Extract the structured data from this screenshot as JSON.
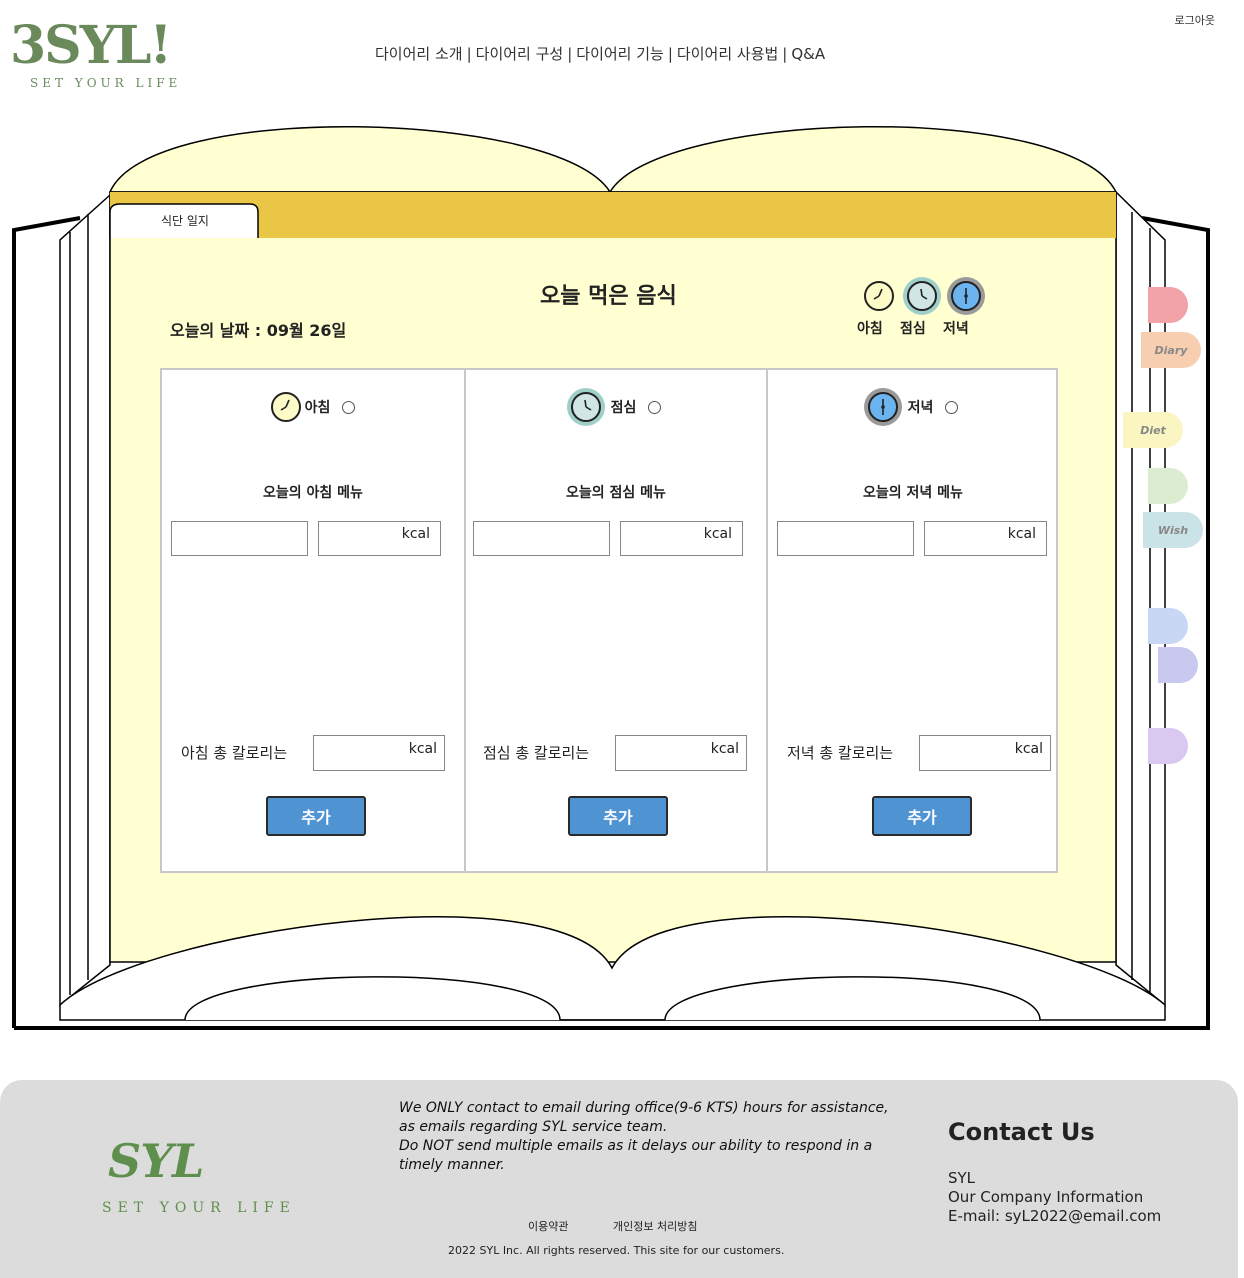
{
  "header": {
    "logo_text": "3SYL!",
    "logo_sub": "SET YOUR LIFE",
    "nav": [
      "다이어리 소개",
      "다이어리 구성",
      "다이어리 기능",
      "다이어리 사용법",
      "Q&A"
    ],
    "nav_separator": "|",
    "logout": "로그아웃"
  },
  "book": {
    "tab_label": "식단 일지",
    "title": "오늘 먹은 음식",
    "date_label": "오늘의 날짜 : 09월 26일",
    "legend": [
      "아침",
      "점심",
      "저녁"
    ],
    "colors": {
      "page": "#ffffd1",
      "top_bar": "#e9c646",
      "button": "#4f93d3"
    }
  },
  "meals": [
    {
      "name": "아침",
      "menu_title": "오늘의 아침 메뉴",
      "food_value": "",
      "kcal_unit": "kcal",
      "total_label": "아침 총 칼로리는",
      "total_unit": "kcal",
      "add_label": "추가",
      "icon_bg": "#fdfbc8",
      "icon_ring": "#f4ecb0"
    },
    {
      "name": "점심",
      "menu_title": "오늘의 점심 메뉴",
      "food_value": "",
      "kcal_unit": "kcal",
      "total_label": "점심 총 칼로리는",
      "total_unit": "kcal",
      "add_label": "추가",
      "icon_bg": "#cfe6e4",
      "icon_ring": "#9fcfc9"
    },
    {
      "name": "저녁",
      "menu_title": "오늘의 저녁 메뉴",
      "food_value": "",
      "kcal_unit": "kcal",
      "total_label": "저녁 총 칼로리는",
      "total_unit": "kcal",
      "add_label": "추가",
      "icon_bg": "#6bb4f0",
      "icon_ring": "#9a9a9a"
    }
  ],
  "side_tabs": [
    {
      "label": "",
      "color": "#f2a3a8"
    },
    {
      "label": "Diary",
      "color": "#f8ceb1"
    },
    {
      "label": "Diet",
      "color": "#fbf5c2"
    },
    {
      "label": "",
      "color": "#dcecd1"
    },
    {
      "label": "Wish",
      "color": "#c9e3e6"
    },
    {
      "label": "",
      "color": "#c8d8f4"
    },
    {
      "label": "",
      "color": "#c9c9ef"
    },
    {
      "label": "",
      "color": "#d9c8f0"
    }
  ],
  "footer": {
    "logo_text": "SYL",
    "logo_sub": "SET YOUR LIFE",
    "notice": [
      "We ONLY contact to email during office(9-6 KTS) hours for assistance,",
      "as emails regarding SYL service team.",
      "Do NOT send multiple emails as it delays our ability to respond in a",
      "timely manner."
    ],
    "terms": "이용약관",
    "privacy": "개인정보 처리방침",
    "copyright": "2022 SYL Inc. All rights reserved. This site for our customers.",
    "contact_title": "Contact Us",
    "contact_lines": [
      "SYL",
      "Our Company Information",
      "E-mail: syL2022@email.com"
    ]
  }
}
